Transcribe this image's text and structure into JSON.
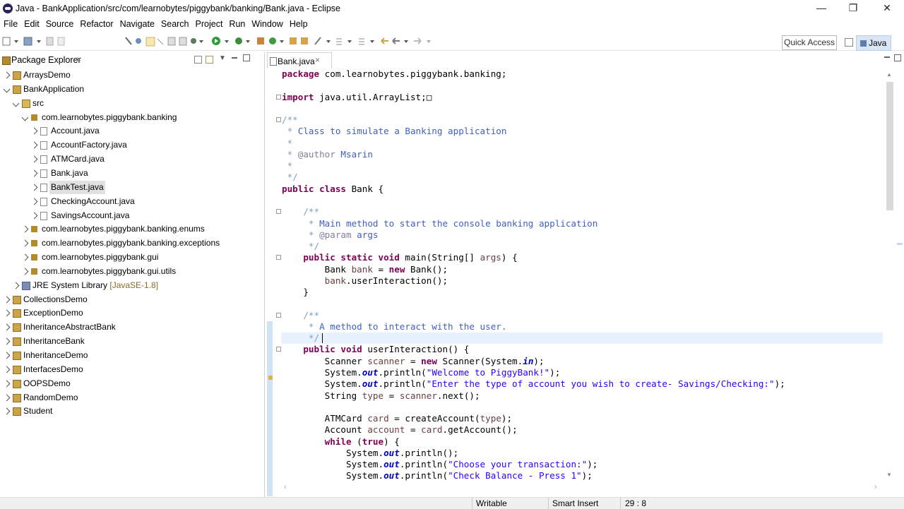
{
  "window": {
    "title": "Java - BankApplication/src/com/learnobytes/piggybank/banking/Bank.java - Eclipse"
  },
  "menu": [
    "File",
    "Edit",
    "Source",
    "Refactor",
    "Navigate",
    "Search",
    "Project",
    "Run",
    "Window",
    "Help"
  ],
  "toolbar": {
    "quick_access": "Quick Access",
    "perspective": "Java"
  },
  "package_explorer": {
    "title": "Package Explorer",
    "items": [
      {
        "label": "ArraysDemo",
        "depth": 0,
        "state": "closed",
        "icon": "project"
      },
      {
        "label": "BankApplication",
        "depth": 0,
        "state": "open",
        "icon": "project"
      },
      {
        "label": "src",
        "depth": 1,
        "state": "open",
        "icon": "source-folder"
      },
      {
        "label": "com.learnobytes.piggybank.banking",
        "depth": 2,
        "state": "open",
        "icon": "package"
      },
      {
        "label": "Account.java",
        "depth": 3,
        "state": "closed",
        "icon": "java-file"
      },
      {
        "label": "AccountFactory.java",
        "depth": 3,
        "state": "closed",
        "icon": "java-file"
      },
      {
        "label": "ATMCard.java",
        "depth": 3,
        "state": "closed",
        "icon": "java-file"
      },
      {
        "label": "Bank.java",
        "depth": 3,
        "state": "closed",
        "icon": "java-file"
      },
      {
        "label": "BankTest.java",
        "depth": 3,
        "state": "closed",
        "icon": "java-file",
        "selected": true
      },
      {
        "label": "CheckingAccount.java",
        "depth": 3,
        "state": "closed",
        "icon": "java-file"
      },
      {
        "label": "SavingsAccount.java",
        "depth": 3,
        "state": "closed",
        "icon": "java-file"
      },
      {
        "label": "com.learnobytes.piggybank.banking.enums",
        "depth": 2,
        "state": "closed",
        "icon": "package"
      },
      {
        "label": "com.learnobytes.piggybank.banking.exceptions",
        "depth": 2,
        "state": "closed",
        "icon": "package"
      },
      {
        "label": "com.learnobytes.piggybank.gui",
        "depth": 2,
        "state": "closed",
        "icon": "package"
      },
      {
        "label": "com.learnobytes.piggybank.gui.utils",
        "depth": 2,
        "state": "closed",
        "icon": "package"
      },
      {
        "label": "JRE System Library",
        "suffix": "[JavaSE-1.8]",
        "depth": 1,
        "state": "closed",
        "icon": "library"
      },
      {
        "label": "CollectionsDemo",
        "depth": 0,
        "state": "closed",
        "icon": "project"
      },
      {
        "label": "ExceptionDemo",
        "depth": 0,
        "state": "closed",
        "icon": "project"
      },
      {
        "label": "InheritanceAbstractBank",
        "depth": 0,
        "state": "closed",
        "icon": "project"
      },
      {
        "label": "InheritanceBank",
        "depth": 0,
        "state": "closed",
        "icon": "project"
      },
      {
        "label": "InheritanceDemo",
        "depth": 0,
        "state": "closed",
        "icon": "project"
      },
      {
        "label": "InterfacesDemo",
        "depth": 0,
        "state": "closed",
        "icon": "project"
      },
      {
        "label": "OOPSDemo",
        "depth": 0,
        "state": "closed",
        "icon": "project"
      },
      {
        "label": "RandomDemo",
        "depth": 0,
        "state": "closed",
        "icon": "project"
      },
      {
        "label": "Student",
        "depth": 0,
        "state": "closed",
        "icon": "project"
      }
    ]
  },
  "editor": {
    "tab": "Bank.java",
    "lines": [
      {
        "fold": "",
        "segs": [
          [
            "kw",
            "package"
          ],
          [
            "",
            "com.learnobytes.piggybank.banking;"
          ]
        ],
        "sep": " "
      },
      {
        "fold": "",
        "segs": []
      },
      {
        "fold": "+",
        "segs": [
          [
            "kw",
            "import"
          ],
          [
            "",
            "java.util.ArrayList;□"
          ]
        ],
        "sep": " "
      },
      {
        "fold": "",
        "segs": []
      },
      {
        "fold": "-",
        "segs": [
          [
            "cm",
            "/**"
          ]
        ]
      },
      {
        "fold": "",
        "segs": [
          [
            "cm",
            " * "
          ],
          [
            "jd",
            "Class to simulate a Banking application"
          ]
        ]
      },
      {
        "fold": "",
        "segs": [
          [
            "cm",
            " *"
          ]
        ]
      },
      {
        "fold": "",
        "segs": [
          [
            "cm",
            " * "
          ],
          [
            "tag",
            "@author"
          ],
          [
            "jd",
            " Msarin"
          ]
        ]
      },
      {
        "fold": "",
        "segs": [
          [
            "cm",
            " *"
          ]
        ]
      },
      {
        "fold": "",
        "segs": [
          [
            "cm",
            " */"
          ]
        ]
      },
      {
        "fold": "",
        "segs": [
          [
            "kw",
            "public class"
          ],
          [
            "",
            "Bank {"
          ]
        ],
        "sep": " "
      },
      {
        "fold": "",
        "segs": []
      },
      {
        "fold": "-",
        "segs": [
          [
            "cm",
            "    /**"
          ]
        ]
      },
      {
        "fold": "",
        "segs": [
          [
            "cm",
            "     * "
          ],
          [
            "jd",
            "Main method to start the console banking application"
          ]
        ]
      },
      {
        "fold": "",
        "segs": [
          [
            "cm",
            "     * "
          ],
          [
            "tag",
            "@param"
          ],
          [
            "jd",
            " args"
          ]
        ]
      },
      {
        "fold": "",
        "segs": [
          [
            "cm",
            "     */"
          ]
        ]
      },
      {
        "fold": "-",
        "segs": [
          [
            "",
            "    "
          ],
          [
            "kw",
            "public static void"
          ],
          [
            "",
            " main(String[] "
          ],
          [
            "var",
            "args"
          ],
          [
            "",
            ") {"
          ]
        ]
      },
      {
        "fold": "",
        "segs": [
          [
            "",
            "        Bank "
          ],
          [
            "var",
            "bank"
          ],
          [
            "",
            " = "
          ],
          [
            "kw",
            "new"
          ],
          [
            "",
            " Bank();"
          ]
        ]
      },
      {
        "fold": "",
        "segs": [
          [
            "",
            "        "
          ],
          [
            "var",
            "bank"
          ],
          [
            "",
            ".userInteraction();"
          ]
        ]
      },
      {
        "fold": "",
        "segs": [
          [
            "",
            "    }"
          ]
        ]
      },
      {
        "fold": "",
        "segs": []
      },
      {
        "fold": "-",
        "segs": [
          [
            "cm",
            "    /**"
          ]
        ]
      },
      {
        "fold": "",
        "segs": [
          [
            "cm",
            "     * "
          ],
          [
            "jd",
            "A method to interact with the user."
          ]
        ]
      },
      {
        "fold": "",
        "segs": [
          [
            "cm",
            "     */"
          ]
        ]
      },
      {
        "fold": "-",
        "segs": [
          [
            "",
            "    "
          ],
          [
            "kw",
            "public void"
          ],
          [
            "",
            " userInteraction() {"
          ]
        ]
      },
      {
        "fold": "",
        "segs": [
          [
            "",
            "        Scanner "
          ],
          [
            "var",
            "scanner"
          ],
          [
            "",
            " = "
          ],
          [
            "kw",
            "new"
          ],
          [
            "",
            " Scanner(System."
          ],
          [
            "fld",
            "in"
          ],
          [
            "",
            ");"
          ]
        ]
      },
      {
        "fold": "",
        "segs": [
          [
            "",
            "        System."
          ],
          [
            "fld",
            "out"
          ],
          [
            "",
            ".println("
          ],
          [
            "str",
            "\"Welcome to PiggyBank!\""
          ],
          [
            "",
            ");"
          ]
        ]
      },
      {
        "fold": "",
        "segs": [
          [
            "",
            "        System."
          ],
          [
            "fld",
            "out"
          ],
          [
            "",
            ".println("
          ],
          [
            "str",
            "\"Enter the type of account you wish to create- Savings/Checking:\""
          ],
          [
            "",
            ");"
          ]
        ]
      },
      {
        "fold": "",
        "segs": [
          [
            "",
            "        String "
          ],
          [
            "var",
            "type"
          ],
          [
            "",
            " = "
          ],
          [
            "var",
            "scanner"
          ],
          [
            "",
            ".next();"
          ]
        ]
      },
      {
        "fold": "",
        "segs": []
      },
      {
        "fold": "",
        "segs": [
          [
            "",
            "        ATMCard "
          ],
          [
            "var",
            "card"
          ],
          [
            "",
            " = createAccount("
          ],
          [
            "var",
            "type"
          ],
          [
            "",
            ");"
          ]
        ]
      },
      {
        "fold": "",
        "segs": [
          [
            "",
            "        Account "
          ],
          [
            "var",
            "account"
          ],
          [
            "",
            " = "
          ],
          [
            "var",
            "card"
          ],
          [
            "",
            ".getAccount();"
          ]
        ]
      },
      {
        "fold": "",
        "segs": [
          [
            "",
            "        "
          ],
          [
            "kw",
            "while"
          ],
          [
            "",
            " ("
          ],
          [
            "kw",
            "true"
          ],
          [
            "",
            ") {"
          ]
        ]
      },
      {
        "fold": "",
        "segs": [
          [
            "",
            "            System."
          ],
          [
            "fld",
            "out"
          ],
          [
            "",
            ".println();"
          ]
        ]
      },
      {
        "fold": "",
        "segs": [
          [
            "",
            "            System."
          ],
          [
            "fld",
            "out"
          ],
          [
            "",
            ".println("
          ],
          [
            "str",
            "\"Choose your transaction:\""
          ],
          [
            "",
            ");"
          ]
        ]
      },
      {
        "fold": "",
        "segs": [
          [
            "",
            "            System."
          ],
          [
            "fld",
            "out"
          ],
          [
            "",
            ".println("
          ],
          [
            "str",
            "\"Check Balance - Press 1\""
          ],
          [
            "",
            ");"
          ]
        ]
      }
    ]
  },
  "status": {
    "mode": "Writable",
    "insert": "Smart Insert",
    "position": "29 : 8"
  }
}
